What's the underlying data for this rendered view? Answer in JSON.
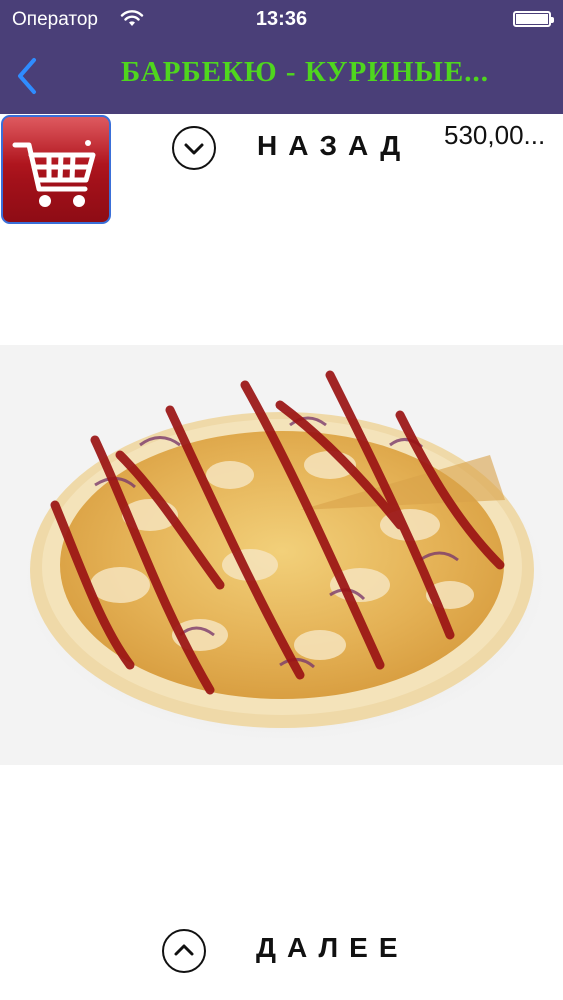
{
  "status_bar": {
    "carrier": "Оператор",
    "time": "13:36"
  },
  "nav": {
    "title": "БАРБЕКЮ - КУРИНЫЕ...",
    "back_icon": "chevron-left-icon"
  },
  "product": {
    "cart_icon": "shopping-cart-icon",
    "prev_label": "НАЗАД",
    "next_label": "ДАЛЕЕ",
    "price": "530,00...",
    "prev_icon": "chevron-down-circle-icon",
    "next_icon": "chevron-up-circle-icon",
    "image_subject": "pizza"
  },
  "colors": {
    "bar": "#4a3f78",
    "title": "#4fd61e",
    "back": "#2f8cff",
    "cart_red": "#c0161e"
  }
}
